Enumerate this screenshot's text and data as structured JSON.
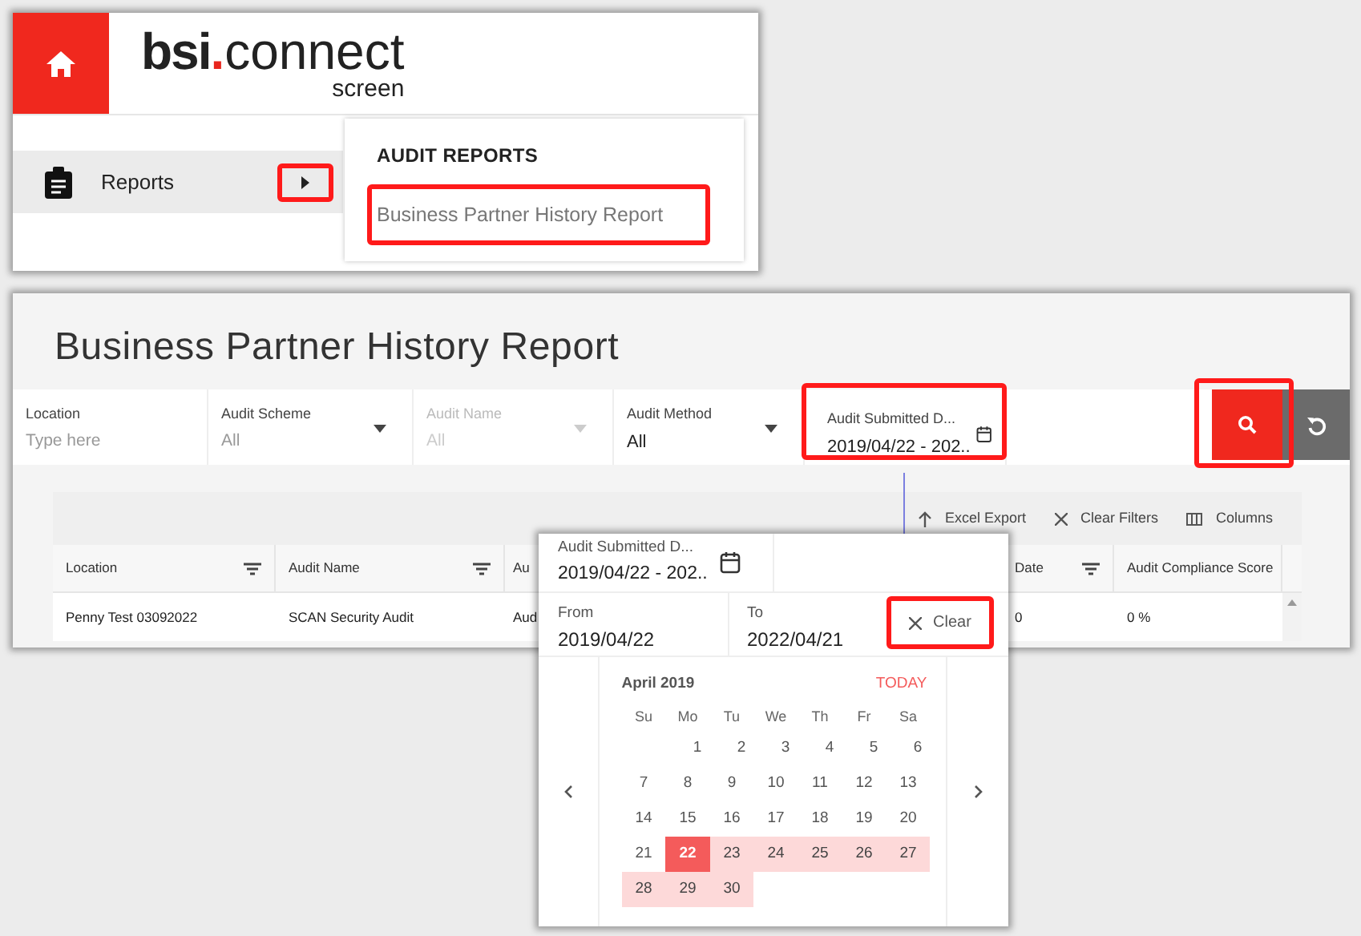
{
  "app_header": {
    "logo": {
      "parts": [
        {
          "text": "bsi",
          "kind": "bold"
        },
        {
          "text": ".",
          "kind": "accent"
        },
        {
          "text": "connect",
          "kind": "light"
        }
      ],
      "subtitle": "screen"
    }
  },
  "sidebar": {
    "items": [
      {
        "label": "Reports",
        "selected": true,
        "arrow_highlighted": true
      }
    ]
  },
  "submenu": {
    "heading": "AUDIT REPORTS",
    "items": [
      {
        "label": "Business Partner History Report",
        "highlighted": true
      }
    ]
  },
  "report": {
    "title": "Business Partner History Report",
    "filters": [
      {
        "kind": "text",
        "label": "Location",
        "placeholder": "Type here",
        "disabled": false,
        "highlighted": false
      },
      {
        "kind": "dropdown",
        "label": "Audit Scheme",
        "placeholder": "All",
        "disabled": false,
        "highlighted": false
      },
      {
        "kind": "dropdown",
        "label": "Audit Name",
        "placeholder": "All",
        "disabled": true,
        "highlighted": false
      },
      {
        "kind": "dropdown",
        "label": "Audit Method",
        "value": "All",
        "disabled": false,
        "highlighted": false
      },
      {
        "kind": "date",
        "label": "Audit Submitted D...",
        "value": "2019/04/22 - 202..",
        "disabled": false,
        "highlighted": true
      }
    ],
    "search_button": {
      "highlighted": true
    },
    "toolbar": [
      {
        "kind": "export",
        "label": "Excel Export"
      },
      {
        "kind": "clear",
        "label": "Clear Filters"
      },
      {
        "kind": "columns",
        "label": "Columns"
      }
    ],
    "table": {
      "columns": [
        {
          "label": "Location",
          "filter": true
        },
        {
          "label": "Audit Name",
          "filter": true
        },
        {
          "label": "Au",
          "filter": false
        },
        {
          "label": "Date",
          "filter": true
        },
        {
          "label": "Audit Compliance Score",
          "filter": false
        }
      ],
      "rows": [
        [
          "Penny Test 03092022",
          "SCAN Security Audit",
          "Aud",
          "0",
          "0 %"
        ]
      ]
    }
  },
  "date_picker": {
    "field_label": "Audit Submitted D...",
    "field_value": "2019/04/22 - 202..",
    "from_label": "From",
    "from_value": "2019/04/22",
    "to_label": "To",
    "to_value": "2022/04/21",
    "clear": {
      "label": "Clear",
      "highlighted": true
    },
    "month": "April 2019",
    "today": "TODAY",
    "weekdays": [
      "Su",
      "Mo",
      "Tu",
      "We",
      "Th",
      "Fr",
      "Sa"
    ],
    "weeks": [
      [
        {
          "day": "1",
          "selected": false,
          "in_range": false
        },
        {
          "day": "2",
          "selected": false,
          "in_range": false
        },
        {
          "day": "3",
          "selected": false,
          "in_range": false
        },
        {
          "day": "4",
          "selected": false,
          "in_range": false
        },
        {
          "day": "5",
          "selected": false,
          "in_range": false
        },
        {
          "day": "6",
          "selected": false,
          "in_range": false
        }
      ],
      [
        {
          "day": "7",
          "selected": false,
          "in_range": false
        },
        {
          "day": "8",
          "selected": false,
          "in_range": false
        },
        {
          "day": "9",
          "selected": false,
          "in_range": false
        },
        {
          "day": "10",
          "selected": false,
          "in_range": false
        },
        {
          "day": "11",
          "selected": false,
          "in_range": false
        },
        {
          "day": "12",
          "selected": false,
          "in_range": false
        },
        {
          "day": "13",
          "selected": false,
          "in_range": false
        }
      ],
      [
        {
          "day": "14",
          "selected": false,
          "in_range": false
        },
        {
          "day": "15",
          "selected": false,
          "in_range": false
        },
        {
          "day": "16",
          "selected": false,
          "in_range": false
        },
        {
          "day": "17",
          "selected": false,
          "in_range": false
        },
        {
          "day": "18",
          "selected": false,
          "in_range": false
        },
        {
          "day": "19",
          "selected": false,
          "in_range": false
        },
        {
          "day": "20",
          "selected": false,
          "in_range": false
        }
      ],
      [
        {
          "day": "21",
          "selected": false,
          "in_range": false
        },
        {
          "day": "22",
          "selected": true,
          "in_range": true
        },
        {
          "day": "23",
          "selected": false,
          "in_range": true
        },
        {
          "day": "24",
          "selected": false,
          "in_range": true
        },
        {
          "day": "25",
          "selected": false,
          "in_range": true
        },
        {
          "day": "26",
          "selected": false,
          "in_range": true
        },
        {
          "day": "27",
          "selected": false,
          "in_range": true
        }
      ],
      [
        {
          "day": "28",
          "selected": false,
          "in_range": true
        },
        {
          "day": "29",
          "selected": false,
          "in_range": true
        },
        {
          "day": "30",
          "selected": false,
          "in_range": true
        }
      ]
    ]
  }
}
